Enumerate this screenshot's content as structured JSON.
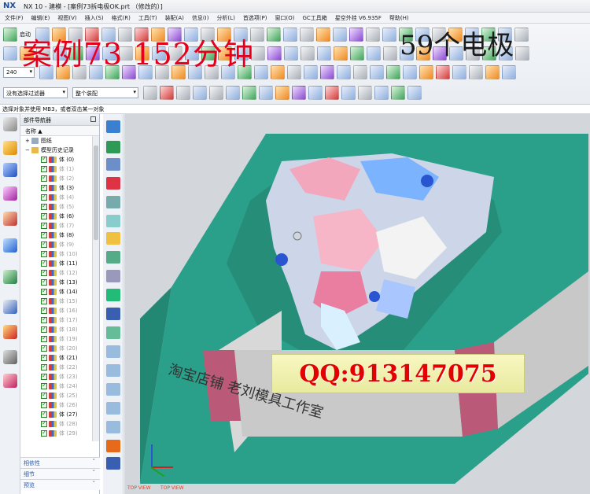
{
  "titlebar": {
    "logo": "NX",
    "title": "NX 10 - 建模 - [案例73拆电极OK.prt （修改的）]"
  },
  "menu": [
    "文件(F)",
    "编辑(E)",
    "视图(V)",
    "插入(S)",
    "格式(R)",
    "工具(T)",
    "装配(A)",
    "信息(I)",
    "分析(L)",
    "首选项(P)",
    "窗口(O)",
    "GC工具箱",
    "星空外挂 V6.935F",
    "帮助(H)"
  ],
  "toolbar": {
    "start_label": "启动",
    "size_value": "240",
    "filter_value": "没有选择过滤器",
    "assembly_value": "整个装配"
  },
  "overlay": {
    "title": "案例73    152分钟",
    "count": "59个电极"
  },
  "statusline": "选择对象并使用 MB3，或者双击某一对象",
  "navigator": {
    "header": "部件导航器",
    "column": "名称",
    "drawing": "图纸",
    "history": "模型历史记录",
    "bodies": [
      {
        "label": "体 (0)",
        "active": true
      },
      {
        "label": "体 (1)",
        "active": false
      },
      {
        "label": "体 (2)",
        "active": false
      },
      {
        "label": "体 (3)",
        "active": true
      },
      {
        "label": "体 (4)",
        "active": false
      },
      {
        "label": "体 (5)",
        "active": false
      },
      {
        "label": "体 (6)",
        "active": true
      },
      {
        "label": "体 (7)",
        "active": false
      },
      {
        "label": "体 (8)",
        "active": true
      },
      {
        "label": "体 (9)",
        "active": false
      },
      {
        "label": "体 (10)",
        "active": false
      },
      {
        "label": "体 (11)",
        "active": true
      },
      {
        "label": "体 (12)",
        "active": false
      },
      {
        "label": "体 (13)",
        "active": true
      },
      {
        "label": "体 (14)",
        "active": true
      },
      {
        "label": "体 (15)",
        "active": false
      },
      {
        "label": "体 (16)",
        "active": false
      },
      {
        "label": "体 (17)",
        "active": false
      },
      {
        "label": "体 (18)",
        "active": false
      },
      {
        "label": "体 (19)",
        "active": false
      },
      {
        "label": "体 (20)",
        "active": false
      },
      {
        "label": "体 (21)",
        "active": true
      },
      {
        "label": "体 (22)",
        "active": false
      },
      {
        "label": "体 (23)",
        "active": false
      },
      {
        "label": "体 (24)",
        "active": false
      },
      {
        "label": "体 (25)",
        "active": false
      },
      {
        "label": "体 (26)",
        "active": false
      },
      {
        "label": "体 (27)",
        "active": true
      },
      {
        "label": "体 (28)",
        "active": false
      },
      {
        "label": "体 (29)",
        "active": false
      }
    ],
    "panels": [
      "相依性",
      "细节",
      "预览"
    ]
  },
  "viewport": {
    "engraving": "淘宝店铺  老刘模具工作室",
    "qq_banner": "QQ:913147075",
    "view_label_1": "TOP VIEW",
    "view_label_2": "TOP VIEW"
  }
}
